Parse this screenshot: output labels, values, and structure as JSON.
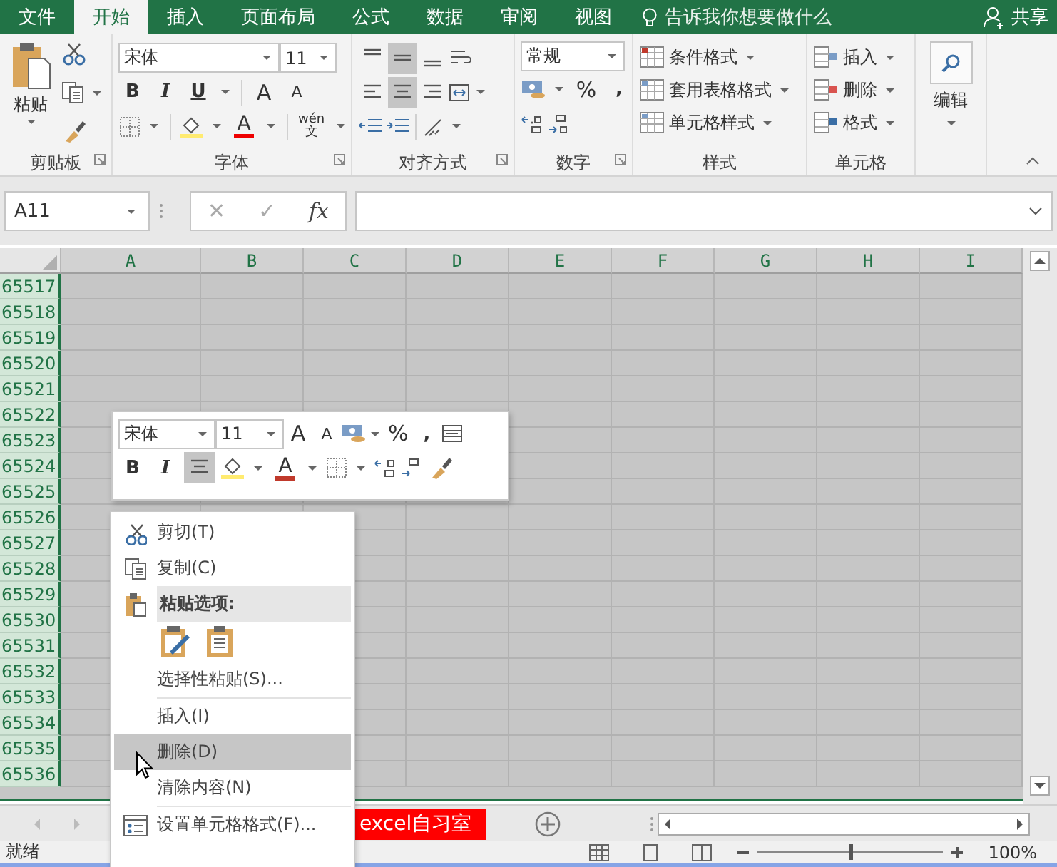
{
  "tabs": [
    {
      "label": "文件",
      "selected": false
    },
    {
      "label": "开始",
      "selected": true
    },
    {
      "label": "插入",
      "selected": false
    },
    {
      "label": "页面布局",
      "selected": false
    },
    {
      "label": "公式",
      "selected": false
    },
    {
      "label": "数据",
      "selected": false
    },
    {
      "label": "审阅",
      "selected": false
    },
    {
      "label": "视图",
      "selected": false
    }
  ],
  "tell_me": "告诉我你想要做什么",
  "share": "共享",
  "ribbon": {
    "paste": "粘贴",
    "font_name": "宋体",
    "font_size": "11",
    "bold": "B",
    "italic": "I",
    "underline": "U",
    "grow_font": "A",
    "shrink_font": "A",
    "font_color": "A",
    "phonetic": "wén",
    "phonetic_char": "文",
    "vertical_align": [
      {
        "selected": false
      },
      {
        "selected": true
      },
      {
        "selected": false
      }
    ],
    "horizontal_align": [
      {
        "selected": false
      },
      {
        "selected": true
      },
      {
        "selected": false
      }
    ],
    "number_format": "常规",
    "percent": "%",
    "comma": ",",
    "styles": [
      "条件格式",
      "套用表格格式",
      "单元格样式"
    ],
    "cells": [
      "插入",
      "删除",
      "格式"
    ],
    "editing": "编辑",
    "groups": [
      "剪贴板",
      "字体",
      "对齐方式",
      "数字",
      "样式",
      "单元格"
    ]
  },
  "formula_bar": {
    "name_box": "A11",
    "cancel": "✕",
    "enter": "✓",
    "fx": "fx"
  },
  "columns": [
    "A",
    "B",
    "C",
    "D",
    "E",
    "F",
    "G",
    "H",
    "I"
  ],
  "rows": [
    "65517",
    "65518",
    "65519",
    "65520",
    "65521",
    "65522",
    "65523",
    "65524",
    "65525",
    "65526",
    "65527",
    "65528",
    "65529",
    "65530",
    "65531",
    "65532",
    "65533",
    "65534",
    "65535",
    "65536"
  ],
  "sheet_tab": "excel自习室",
  "status": {
    "text": "就绪",
    "zoom": "100%",
    "zoom_slider": {
      "level": 0.5
    }
  },
  "mini_toolbar": {
    "font_name": "宋体",
    "font_size": "11",
    "grow_font": "A",
    "shrink_font": "A",
    "percent": "%",
    "comma": ",",
    "bold": "B",
    "italic": "I",
    "center_selected": true,
    "font_color": "A"
  },
  "context_menu": [
    {
      "kind": "cut",
      "label": "剪切(T)",
      "selected": false
    },
    {
      "kind": "copy",
      "label": "复制(C)",
      "selected": false
    },
    {
      "kind": "paste_header",
      "label": "粘贴选项:"
    },
    {
      "kind": "paste_options"
    },
    {
      "kind": "item",
      "label": "选择性粘贴(S)...",
      "selected": false
    },
    {
      "kind": "separator"
    },
    {
      "kind": "item",
      "label": "插入(I)",
      "selected": false
    },
    {
      "kind": "item",
      "label": "删除(D)",
      "selected": true
    },
    {
      "kind": "item",
      "label": "清除内容(N)",
      "selected": false
    },
    {
      "kind": "separator"
    },
    {
      "kind": "format_cells",
      "label": "设置单元格格式(F)...",
      "selected": false
    }
  ]
}
